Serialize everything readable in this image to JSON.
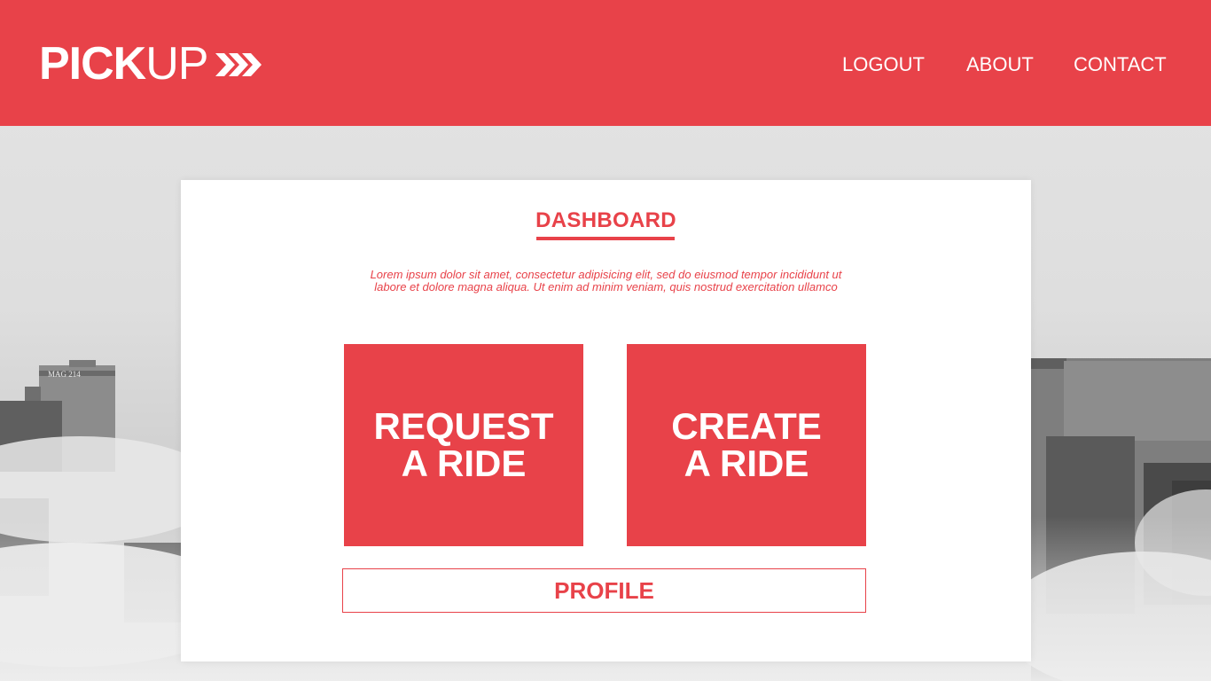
{
  "brand": {
    "name_bold": "PICK",
    "name_light": "UP",
    "arrows_icon": "triple-chevron-right-icon",
    "color": "#e84249"
  },
  "nav": {
    "logout": "LOGOUT",
    "about": "ABOUT",
    "contact": "CONTACT"
  },
  "background": {
    "building_sign": "MAG 214"
  },
  "dashboard": {
    "title": "DASHBOARD",
    "description_line1": "Lorem ipsum dolor sit amet, consectetur adipisicing elit, sed do eiusmod tempor incididunt ut",
    "description_line2": "labore et dolore magna aliqua. Ut enim ad minim veniam, quis nostrud exercitation ullamco",
    "request_line1": "REQUEST",
    "request_line2": "A RIDE",
    "create_line1": "CREATE",
    "create_line2": "A RIDE",
    "profile_label": "PROFILE"
  }
}
